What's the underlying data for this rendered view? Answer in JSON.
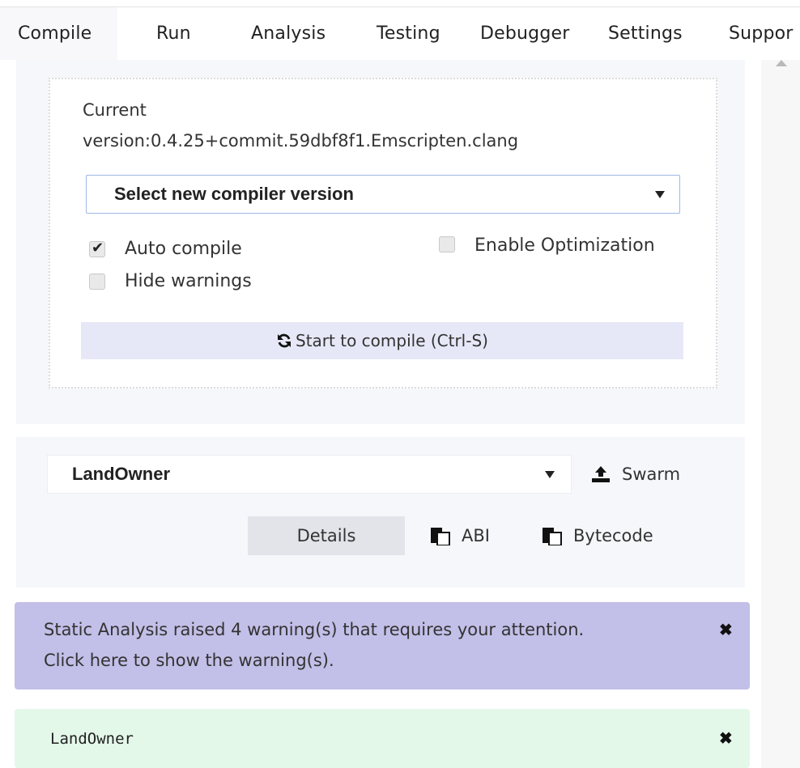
{
  "tabs": [
    "Compile",
    "Run",
    "Analysis",
    "Testing",
    "Debugger",
    "Settings",
    "Suppor"
  ],
  "compile": {
    "current_label": "Current",
    "version_text": "version:0.4.25+commit.59dbf8f1.Emscripten.clang",
    "select_placeholder": "Select new compiler version",
    "auto_compile_label": "Auto compile",
    "auto_compile_checked": true,
    "enable_optimization_label": "Enable Optimization",
    "enable_optimization_checked": false,
    "hide_warnings_label": "Hide warnings",
    "hide_warnings_checked": false,
    "compile_button": "Start to compile (Ctrl-S)"
  },
  "contract": {
    "selected": "LandOwner",
    "swarm_label": "Swarm",
    "details_label": "Details",
    "abi_label": "ABI",
    "bytecode_label": "Bytecode"
  },
  "alerts": {
    "warning_line1": "Static Analysis raised 4 warning(s) that requires your attention.",
    "warning_line2": "Click here to show the warning(s).",
    "close_symbol": "✖",
    "success_text": "LandOwner"
  },
  "icons": [
    "refresh-icon",
    "upload-icon",
    "clipboard-icon",
    "close-icon",
    "dropdown-caret-icon",
    "check-icon"
  ],
  "colors": {
    "warning_bg": "#c2bfe8",
    "success_bg": "#e4f8ea",
    "panel_bg": "#f6f7fb",
    "button_bg": "#e7e8f7"
  }
}
